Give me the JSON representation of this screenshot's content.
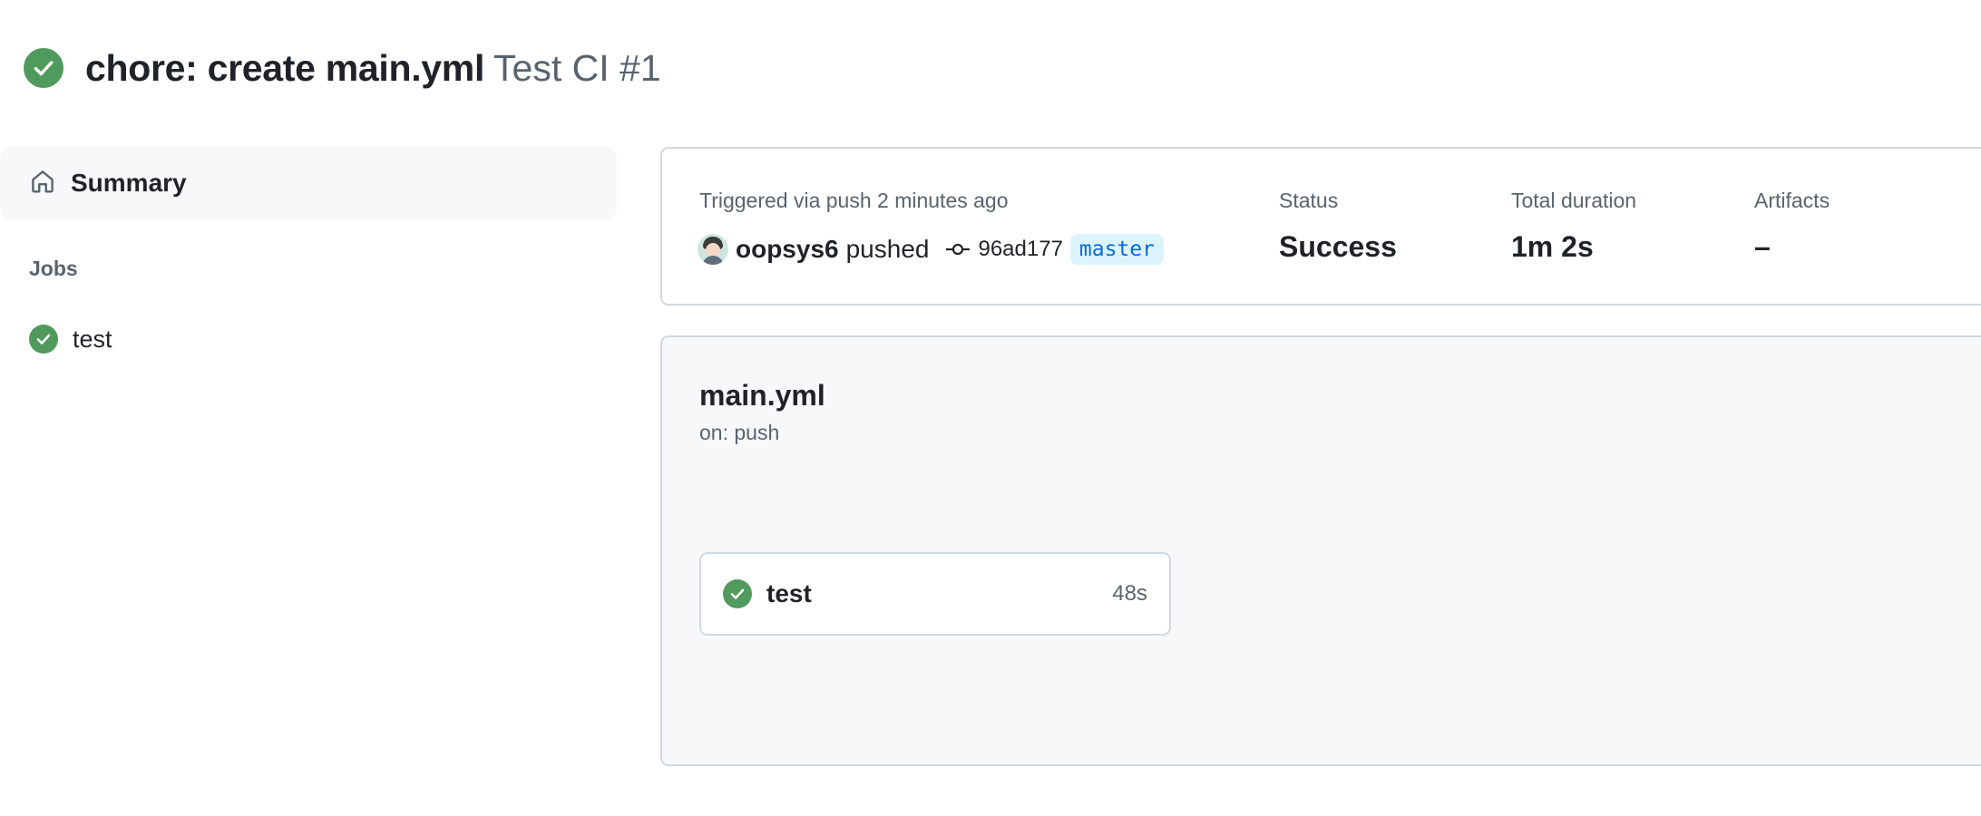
{
  "header": {
    "title": "chore: create main.yml",
    "workflow_run": "Test CI #1",
    "status_icon": "check-circle-icon"
  },
  "sidebar": {
    "summary_label": "Summary",
    "jobs_heading": "Jobs",
    "jobs": [
      {
        "label": "test",
        "status_icon": "check-circle-icon"
      }
    ]
  },
  "summary": {
    "triggered": "Triggered via push 2 minutes ago",
    "user": "oopsys6",
    "action": "pushed",
    "commit_sha": "96ad177",
    "branch": "master",
    "status_label": "Status",
    "status_value": "Success",
    "duration_label": "Total duration",
    "duration_value": "1m 2s",
    "artifacts_label": "Artifacts",
    "artifacts_value": "–"
  },
  "workflow": {
    "name": "main.yml",
    "trigger": "on: push",
    "job": {
      "label": "test",
      "duration": "48s"
    }
  },
  "colors": {
    "success": "#4f9a5c",
    "branch_bg": "#ddf4ff",
    "branch_text": "#0969da",
    "muted": "#59636e",
    "border": "#d1d9e0"
  }
}
